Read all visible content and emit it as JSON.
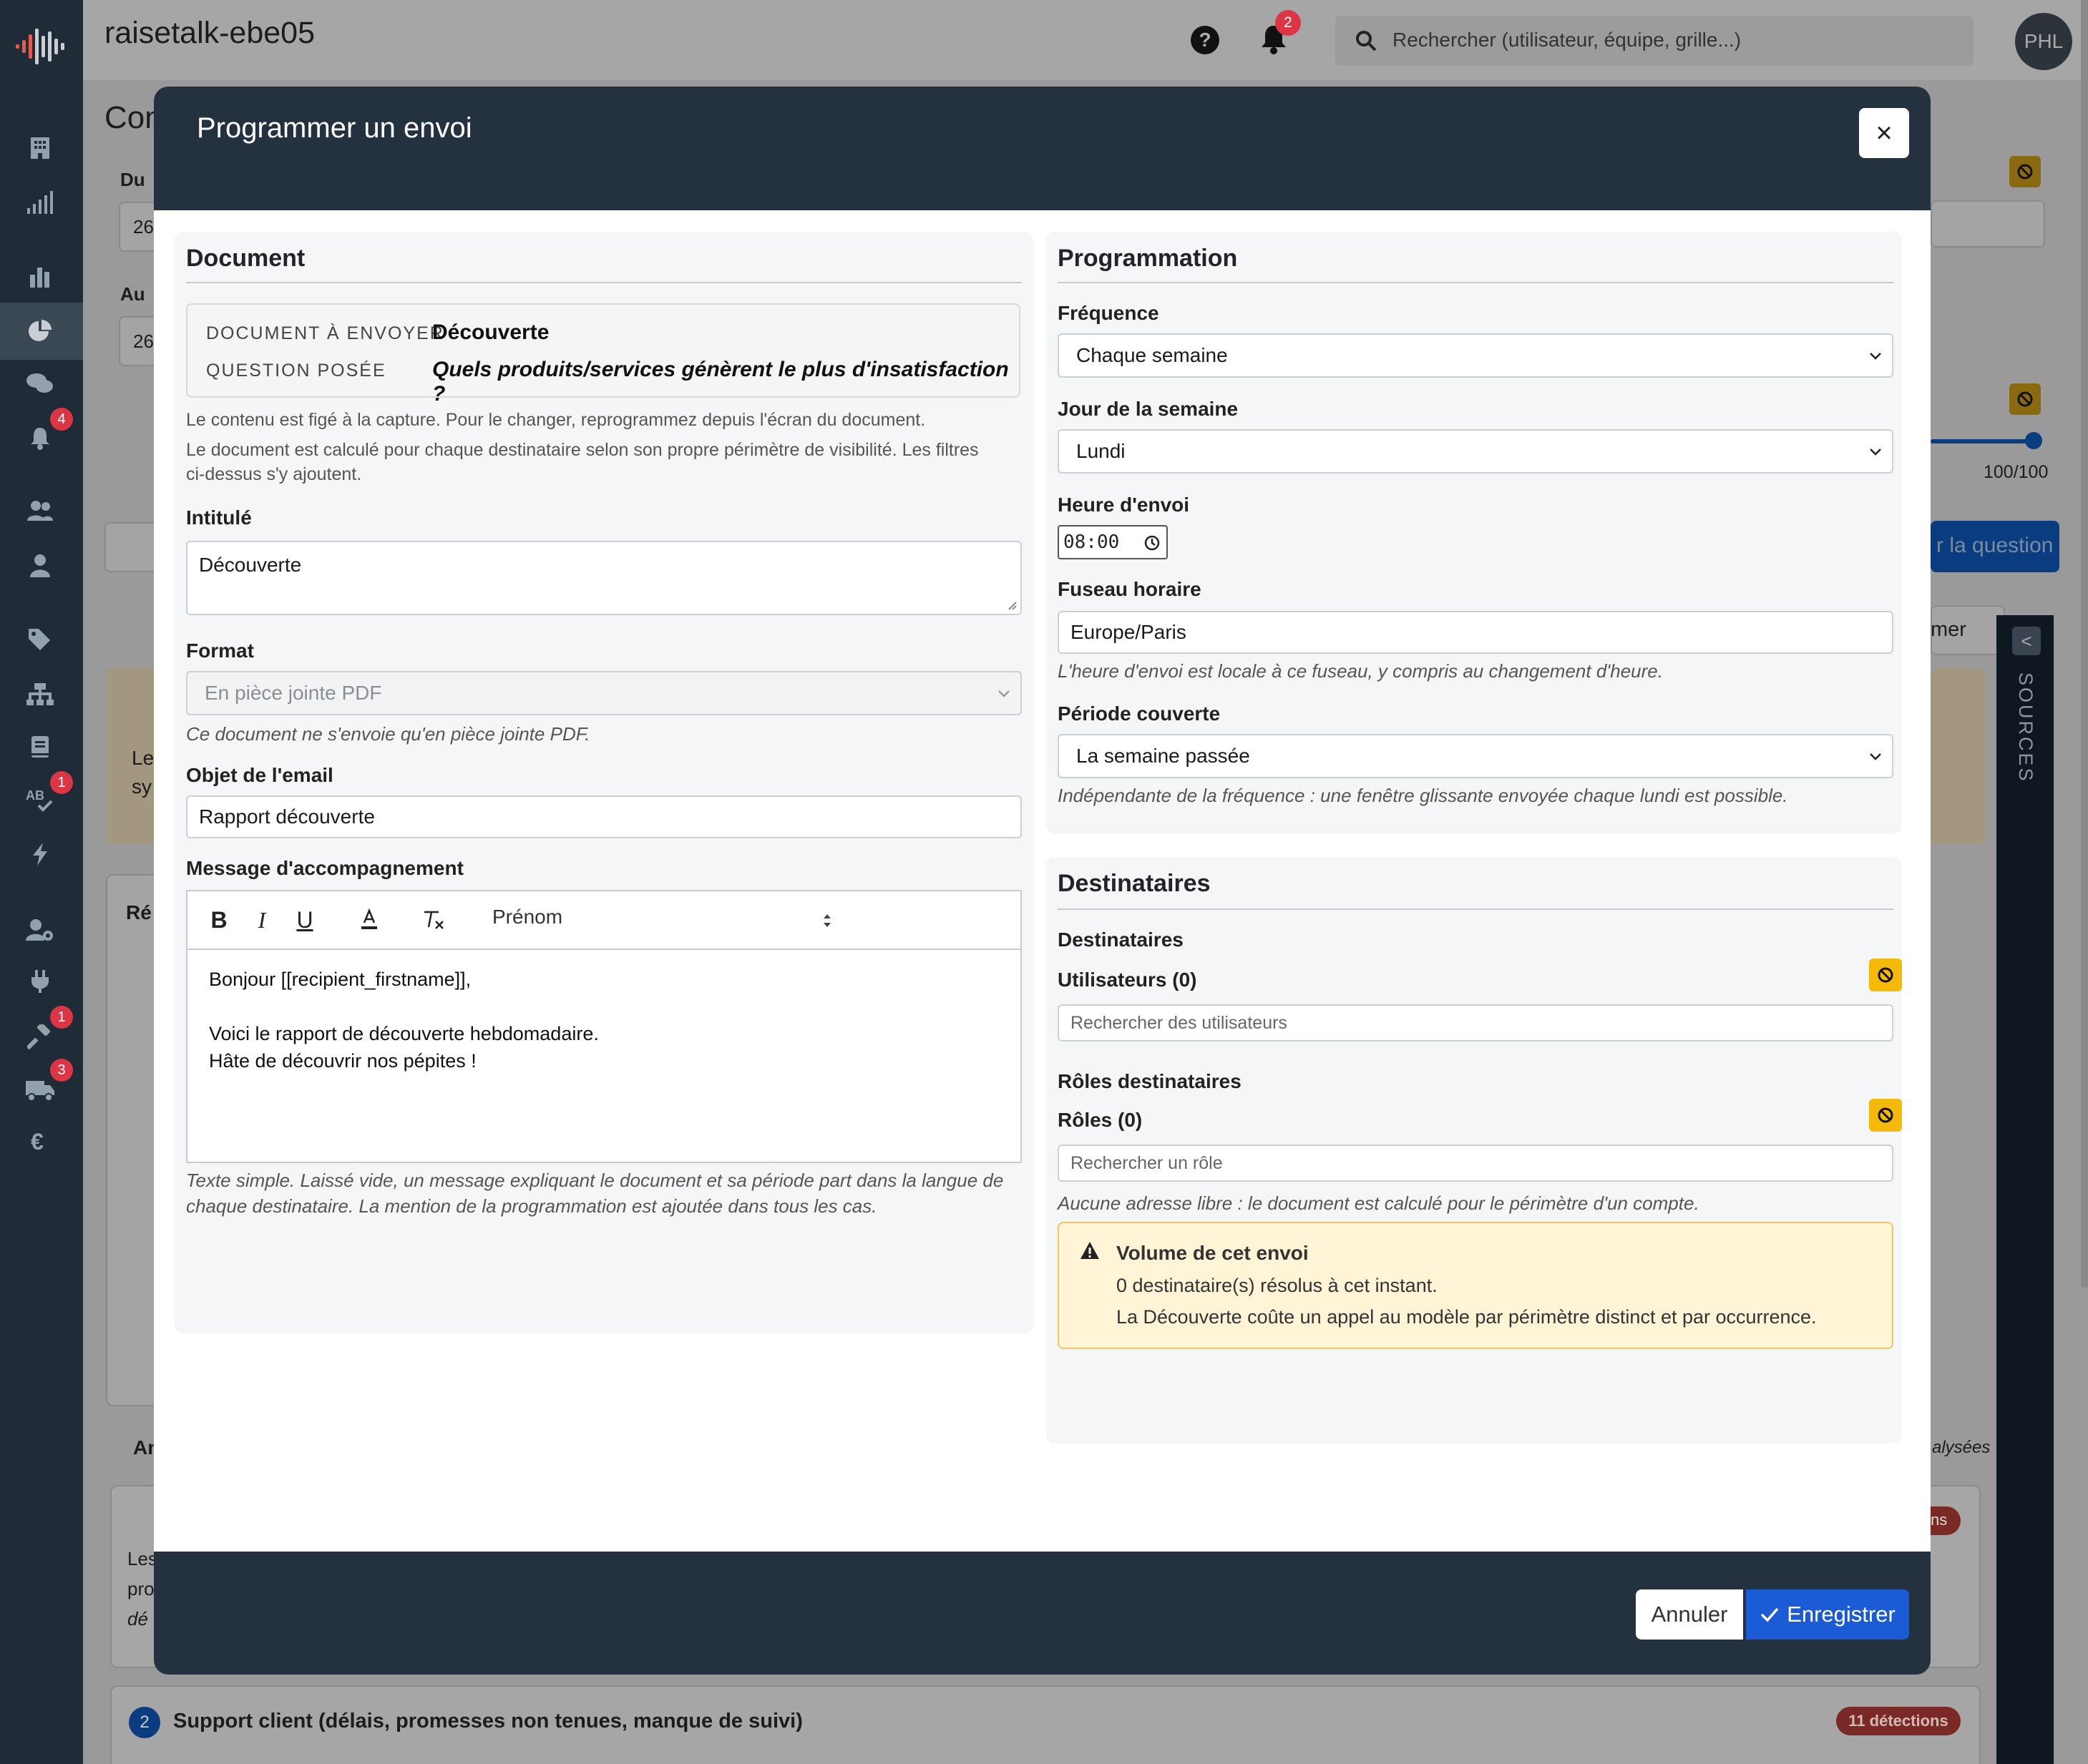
{
  "app": {
    "name": "raisetalk-ebe05",
    "notif_count": "2",
    "search_placeholder": "Rechercher (utilisateur, équipe, grille...)",
    "avatar_initials": "PHL"
  },
  "sidebar": {
    "badges": {
      "notifications": "4",
      "ab_test": "1",
      "tools": "1",
      "delivery": "3"
    }
  },
  "background": {
    "page_title_fragment": "Con",
    "from_label": "Du",
    "to_label": "Au",
    "from_value": "26",
    "to_value": "26",
    "slider_value": "100/100",
    "question_button": "r la question",
    "filter_button": "mer",
    "reply_fragment": "Ré",
    "analysis_fragment": "An",
    "analyzed_fragment": "alysées",
    "card_text_fragments": [
      "Le",
      "sy"
    ],
    "item1_badge_fragment": "ns",
    "item1_text_fragments": [
      "Les",
      "pro",
      "dé"
    ],
    "item2_number": "2",
    "item2_title": "Support client (délais, promesses non tenues, manque de suivi)",
    "item2_badge": "11 détections",
    "sources_label": "SOURCES"
  },
  "modal": {
    "title": "Programmer un envoi",
    "close_label": "×",
    "cancel_label": "Annuler",
    "save_label": "Enregistrer",
    "document": {
      "section_title": "Document",
      "doc_key": "DOCUMENT À ENVOYER",
      "doc_value": "Découverte",
      "question_key": "QUESTION POSÉE",
      "question_value": "Quels produits/services génèrent le plus d'insatisfaction ?",
      "help1": "Le contenu est figé à la capture. Pour le changer, reprogrammez depuis l'écran du document.",
      "help2a": "Le document est calculé pour chaque destinataire selon son propre périmètre de visibilité. Les filtres",
      "help2b": "ci-dessus s'y ajoutent.",
      "title_label": "Intitulé",
      "title_value": "Découverte",
      "format_label": "Format",
      "format_value": "En pièce jointe PDF",
      "format_help": "Ce document ne s'envoie qu'en pièce jointe PDF.",
      "subject_label": "Objet de l'email",
      "subject_value": "Rapport découverte",
      "message_label": "Message d'accompagnement",
      "variable_select": "Prénom",
      "message_lines": [
        "Bonjour [[recipient_firstname]],",
        "",
        "Voici le rapport de découverte hebdomadaire.",
        "Hâte de découvrir nos pépites !"
      ],
      "message_help1": "Texte simple. Laissé vide, un message expliquant le document et sa période part dans la langue de",
      "message_help2": "chaque destinataire. La mention de la programmation est ajoutée dans tous les cas."
    },
    "schedule": {
      "section_title": "Programmation",
      "freq_label": "Fréquence",
      "freq_value": "Chaque semaine",
      "day_label": "Jour de la semaine",
      "day_value": "Lundi",
      "time_label": "Heure d'envoi",
      "time_value": "08:00",
      "tz_label": "Fuseau horaire",
      "tz_value": "Europe/Paris",
      "tz_help": "L'heure d'envoi est locale à ce fuseau, y compris au changement d'heure.",
      "period_label": "Période couverte",
      "period_value": "La semaine passée",
      "period_help": "Indépendante de la fréquence : une fenêtre glissante envoyée chaque lundi est possible."
    },
    "recipients": {
      "section_title": "Destinataires",
      "sub_label": "Destinataires",
      "users_label": "Utilisateurs (0)",
      "users_placeholder": "Rechercher des utilisateurs",
      "roles_title": "Rôles destinataires",
      "roles_label": "Rôles (0)",
      "roles_placeholder": "Rechercher un rôle",
      "roles_help": "Aucune adresse libre : le document est calculé pour le périmètre d'un compte.",
      "warn_title": "Volume de cet envoi",
      "warn_line1": "0 destinataire(s) résolus à cet instant.",
      "warn_line2": "La Découverte coûte un appel au modèle par périmètre distinct et par occurrence."
    }
  }
}
